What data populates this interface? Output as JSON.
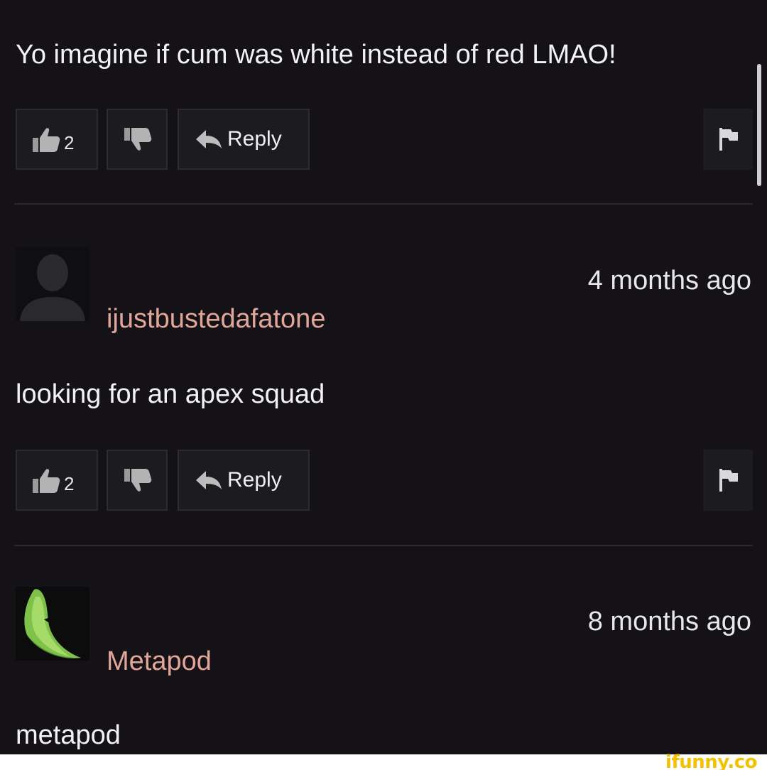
{
  "comments": [
    {
      "text": "Yo imagine if cum was white instead of red LMAO!",
      "likes": "2",
      "reply_label": "Reply"
    },
    {
      "username": "ijustbustedafatone",
      "timestamp": "4 months ago",
      "text": "looking for an apex squad",
      "likes": "2",
      "reply_label": "Reply",
      "avatar_icon": "default-user-silhouette-icon"
    },
    {
      "username": "Metapod",
      "timestamp": "8 months ago",
      "text": "metapod",
      "avatar_icon": "metapod-avatar"
    }
  ],
  "watermark": "ifunny.co",
  "colors": {
    "background": "#141216",
    "username": "#e2a59a",
    "button_bg": "#1c1b1f",
    "watermark": "#f2c200"
  }
}
